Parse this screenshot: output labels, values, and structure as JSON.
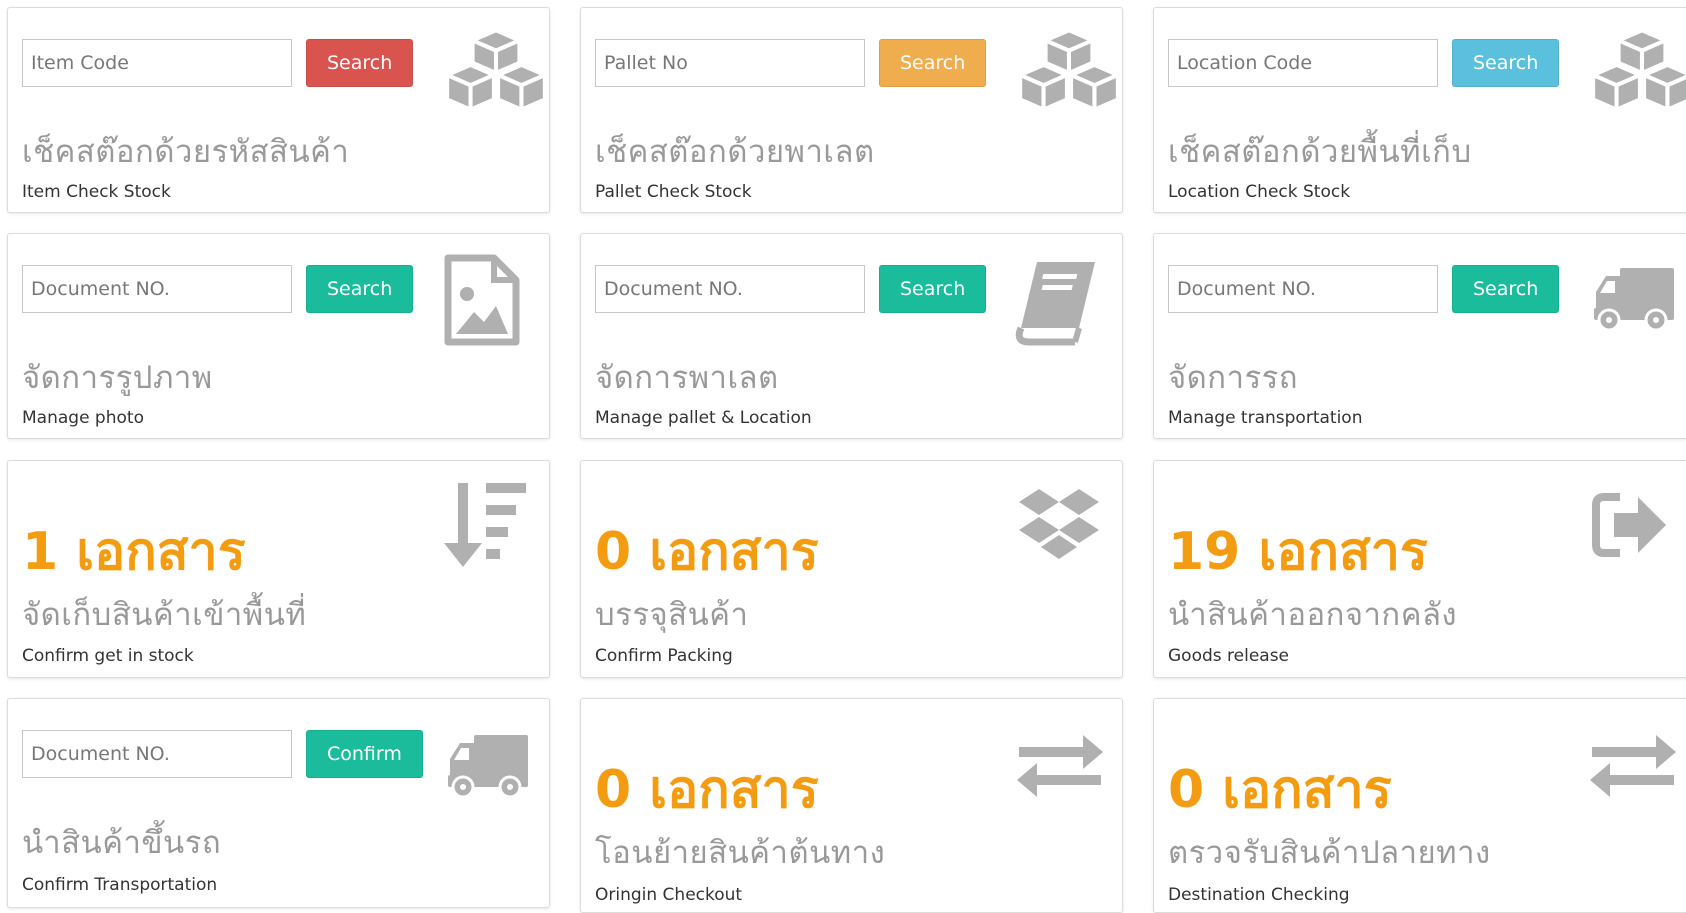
{
  "colors": {
    "red": "#d9534f",
    "orange": "#f0ad4e",
    "blue": "#5bc0de",
    "green": "#1abc9c",
    "count_orange": "#f39c12",
    "icon_gray": "#b0b0b0"
  },
  "cards": {
    "item_check": {
      "placeholder": "Item Code",
      "button": "Search",
      "thai": "เช็คสต๊อกด้วยรหัสสินค้า",
      "eng": "Item Check Stock",
      "icon": "cubes-icon"
    },
    "pallet_check": {
      "placeholder": "Pallet No",
      "button": "Search",
      "thai": "เช็คสต๊อกด้วยพาเลต",
      "eng": "Pallet Check Stock",
      "icon": "cubes-icon"
    },
    "location_check": {
      "placeholder": "Location Code",
      "button": "Search",
      "thai": "เช็คสต๊อกด้วยพื้นที่เก็บ",
      "eng": "Location Check Stock",
      "icon": "cubes-icon"
    },
    "manage_photo": {
      "placeholder": "Document NO.",
      "button": "Search",
      "thai": "จัดการรูปภาพ",
      "eng": "Manage photo",
      "icon": "image-file-icon"
    },
    "manage_pallet": {
      "placeholder": "Document NO.",
      "button": "Search",
      "thai": "จัดการพาเลต",
      "eng": "Manage pallet & Location",
      "icon": "book-icon"
    },
    "manage_transport": {
      "placeholder": "Document NO.",
      "button": "Search",
      "thai": "จัดการรถ",
      "eng": "Manage transportation",
      "icon": "truck-icon"
    },
    "get_in_stock": {
      "count": "1 เอกสาร",
      "thai": "จัดเก็บสินค้าเข้าพื้นที่",
      "eng": "Confirm get in stock",
      "icon": "sort-amount-down-icon"
    },
    "packing": {
      "count": "0 เอกสาร",
      "thai": "บรรจุสินค้า",
      "eng": "Confirm Packing",
      "icon": "dropbox-icon"
    },
    "goods_release": {
      "count": "19 เอกสาร",
      "thai": "นำสินค้าออกจากคลัง",
      "eng": "Goods release",
      "icon": "sign-out-icon"
    },
    "confirm_transport": {
      "placeholder": "Document NO.",
      "button": "Confirm",
      "thai": "นำสินค้าขึ้นรถ",
      "eng": "Confirm Transportation",
      "icon": "truck-icon"
    },
    "origin_checkout": {
      "count": "0 เอกสาร",
      "thai": "โอนย้ายสินค้าต้นทาง",
      "eng": "Oringin Checkout",
      "icon": "exchange-icon"
    },
    "destination_checking": {
      "count": "0 เอกสาร",
      "thai": "ตรวจรับสินค้าปลายทาง",
      "eng": "Destination Checking",
      "icon": "exchange-icon"
    }
  }
}
